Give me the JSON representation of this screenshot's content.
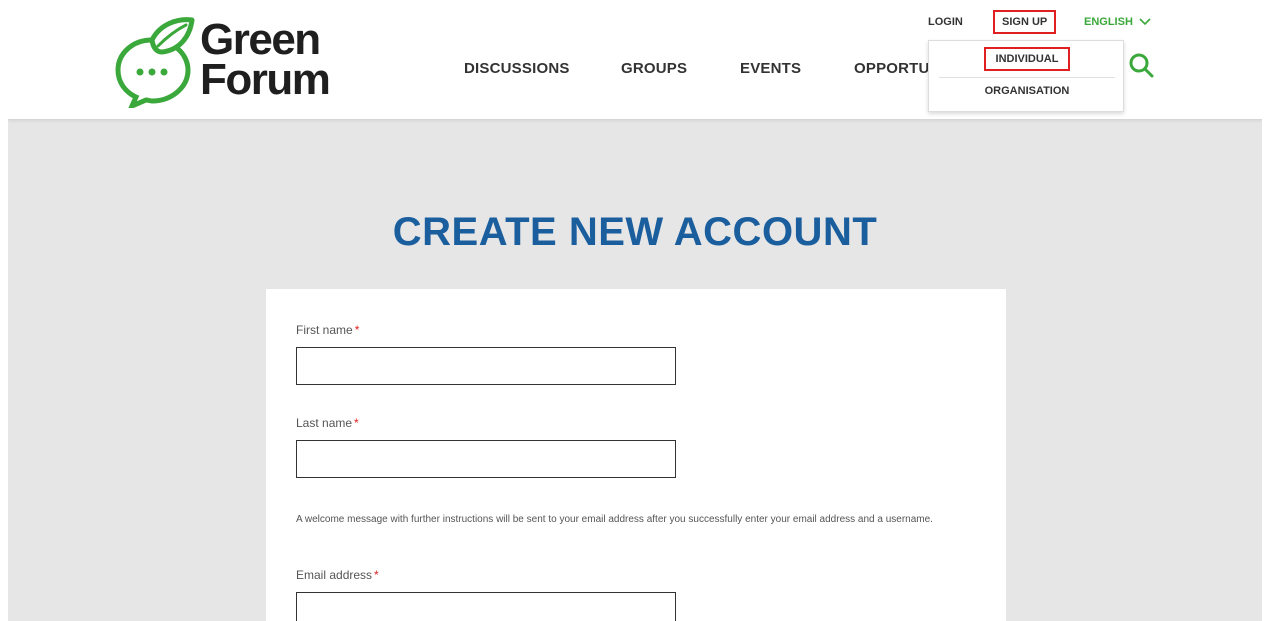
{
  "header": {
    "logo": {
      "line1": "Green",
      "line2": "Forum",
      "icon": "chat-bubble-leaf-icon"
    },
    "nav": [
      "DISCUSSIONS",
      "GROUPS",
      "EVENTS",
      "OPPORTUNITIES"
    ],
    "top_links": {
      "login": "LOGIN",
      "signup": "SIGN UP",
      "language": "ENGLISH"
    },
    "signup_dropdown": {
      "individual": "INDIVIDUAL",
      "organisation": "ORGANISATION"
    },
    "search_icon": "search-icon"
  },
  "main": {
    "title": "CREATE NEW ACCOUNT",
    "fields": {
      "first_name_label": "First name",
      "last_name_label": "Last name",
      "email_label": "Email address",
      "required_marker": "*"
    },
    "help_text": "A welcome message with further instructions will be sent to your email address after you successfully enter your email address and a username."
  },
  "colors": {
    "brand_green": "#3aa83a",
    "title_blue": "#1a5e9e",
    "highlight_red": "#e02020"
  }
}
